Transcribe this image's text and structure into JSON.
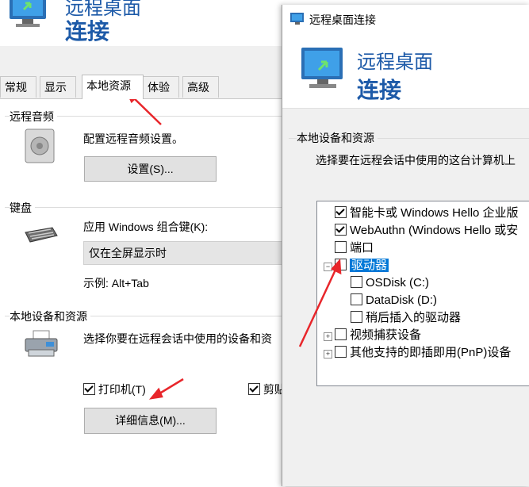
{
  "back": {
    "title_line1": "远程桌面",
    "title_line2": "连接",
    "tabs": [
      "常规",
      "显示",
      "本地资源",
      "体验",
      "高级"
    ],
    "audio": {
      "group": "远程音频",
      "desc": "配置远程音频设置。",
      "button": "设置(S)..."
    },
    "keyboard": {
      "group": "键盘",
      "desc": "应用 Windows 组合键(K):",
      "combo": "仅在全屏显示时",
      "example": "示例: Alt+Tab"
    },
    "devices": {
      "group": "本地设备和资源",
      "desc": "选择你要在远程会话中使用的设备和资",
      "printer": "打印机(T)",
      "clipboard": "剪贴",
      "button": "详细信息(M)..."
    }
  },
  "front": {
    "window_title": "远程桌面连接",
    "title_line1": "远程桌面",
    "title_line2": "连接",
    "group": "本地设备和资源",
    "desc": "选择要在远程会话中使用的这台计算机上",
    "items": [
      {
        "label": "智能卡或 Windows Hello 企业版",
        "checked": true
      },
      {
        "label": "WebAuthn (Windows Hello 或安",
        "checked": true
      },
      {
        "label": "端口",
        "checked": false
      },
      {
        "label": "驱动器",
        "checked": false,
        "expanded": true,
        "selected": true
      },
      {
        "label": "OSDisk (C:)",
        "checked": false
      },
      {
        "label": "DataDisk (D:)",
        "checked": false
      },
      {
        "label": "稍后插入的驱动器",
        "checked": false
      },
      {
        "label": "视频捕获设备",
        "checked": false,
        "expanded": false
      },
      {
        "label": "其他支持的即插即用(PnP)设备",
        "checked": false,
        "expanded": false
      }
    ]
  },
  "colors": {
    "accent": "#0078d7",
    "title_blue": "#1d5aa8",
    "arrow": "#e8262b"
  }
}
